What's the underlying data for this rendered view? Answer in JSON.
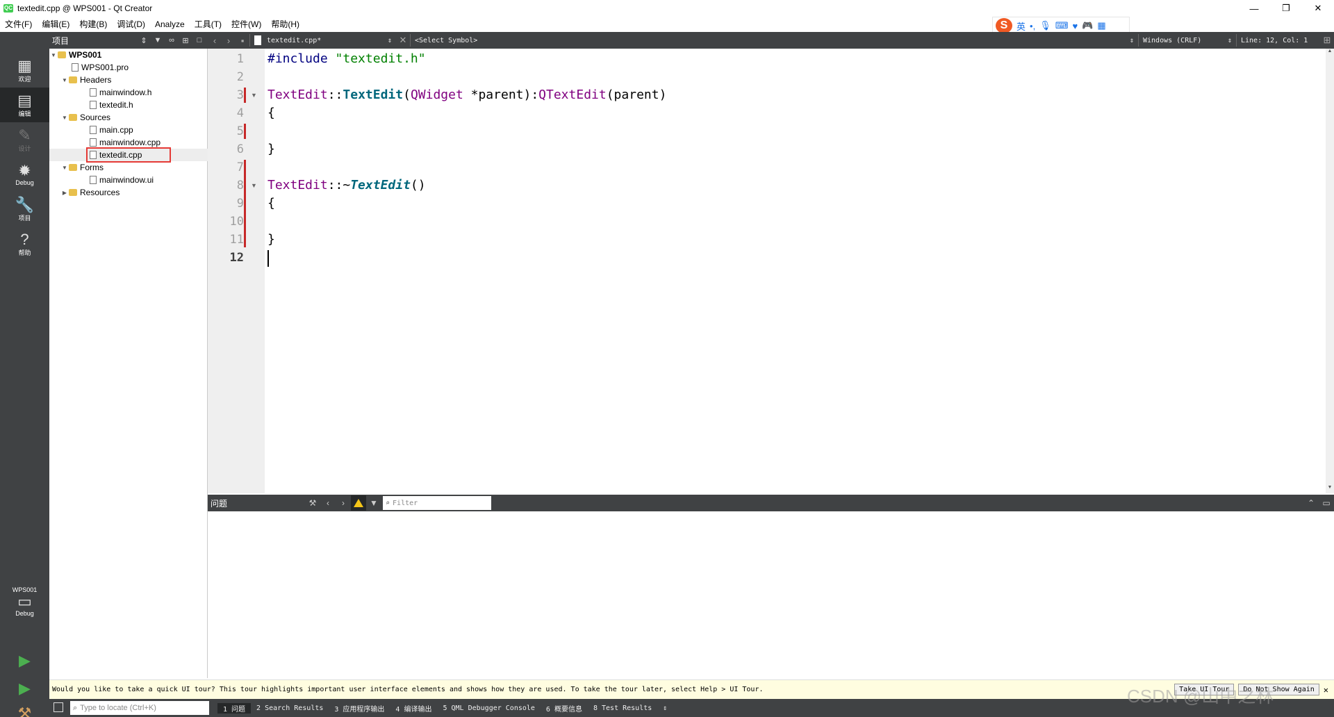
{
  "window": {
    "title": "textedit.cpp @ WPS001 - Qt Creator",
    "app_icon_text": "QC",
    "minimize": "—",
    "restore": "❐",
    "close": "✕"
  },
  "menubar": {
    "items": [
      "文件(F)",
      "编辑(E)",
      "构建(B)",
      "调试(D)",
      "Analyze",
      "工具(T)",
      "控件(W)",
      "帮助(H)"
    ]
  },
  "ime": {
    "logo": "S",
    "mode": "英"
  },
  "modes": [
    {
      "label": "欢迎",
      "icon": "grid-icon"
    },
    {
      "label": "编辑",
      "icon": "edit-icon"
    },
    {
      "label": "设计",
      "icon": "pencil-icon"
    },
    {
      "label": "Debug",
      "icon": "bug-icon"
    },
    {
      "label": "项目",
      "icon": "wrench-icon"
    },
    {
      "label": "帮助",
      "icon": "help-icon"
    }
  ],
  "kit": {
    "project": "WPS001",
    "config": "Debug"
  },
  "project_panel": {
    "title": "项目",
    "tree": [
      {
        "label": "WPS001",
        "level": 0,
        "type": "project",
        "expanded": true
      },
      {
        "label": "WPS001.pro",
        "level": 1,
        "type": "file"
      },
      {
        "label": "Headers",
        "level": 1,
        "type": "folder",
        "expanded": true
      },
      {
        "label": "mainwindow.h",
        "level": 2,
        "type": "file"
      },
      {
        "label": "textedit.h",
        "level": 2,
        "type": "file"
      },
      {
        "label": "Sources",
        "level": 1,
        "type": "folder",
        "expanded": true
      },
      {
        "label": "main.cpp",
        "level": 2,
        "type": "file"
      },
      {
        "label": "mainwindow.cpp",
        "level": 2,
        "type": "file"
      },
      {
        "label": "textedit.cpp",
        "level": 2,
        "type": "file",
        "selected": true
      },
      {
        "label": "Forms",
        "level": 1,
        "type": "folder",
        "expanded": true
      },
      {
        "label": "mainwindow.ui",
        "level": 2,
        "type": "file"
      },
      {
        "label": "Resources",
        "level": 1,
        "type": "folder",
        "expanded": false
      }
    ]
  },
  "editor_toolbar": {
    "file": "textedit.cpp*",
    "symbol": "<Select Symbol>",
    "line_ending": "Windows (CRLF)",
    "position": "Line: 12, Col: 1"
  },
  "editor": {
    "line_numbers": [
      "1",
      "2",
      "3",
      "4",
      "5",
      "6",
      "7",
      "8",
      "9",
      "10",
      "11",
      "12"
    ],
    "current_line": 12,
    "lines": [
      "#include \"textedit.h\"",
      "",
      "TextEdit::TextEdit(QWidget *parent):QTextEdit(parent)",
      "{",
      "",
      "}",
      "",
      "TextEdit::~TextEdit()",
      "{",
      "",
      "}",
      ""
    ]
  },
  "issues": {
    "title": "问题",
    "filter_placeholder": "Filter"
  },
  "tour": {
    "message": "Would you like to take a quick UI tour? This tour highlights important user interface elements and shows how they are used. To take the tour later, select Help > UI Tour.",
    "take_tour": "Take UI Tour",
    "dont_show": "Do Not Show Again"
  },
  "statusbar": {
    "locate_placeholder": "Type to locate (Ctrl+K)",
    "tabs": [
      "1 问题",
      "2 Search Results",
      "3 应用程序输出",
      "4 编译输出",
      "5 QML Debugger Console",
      "6 概要信息",
      "8 Test Results"
    ]
  },
  "watermark": "CSDN @山中之林"
}
